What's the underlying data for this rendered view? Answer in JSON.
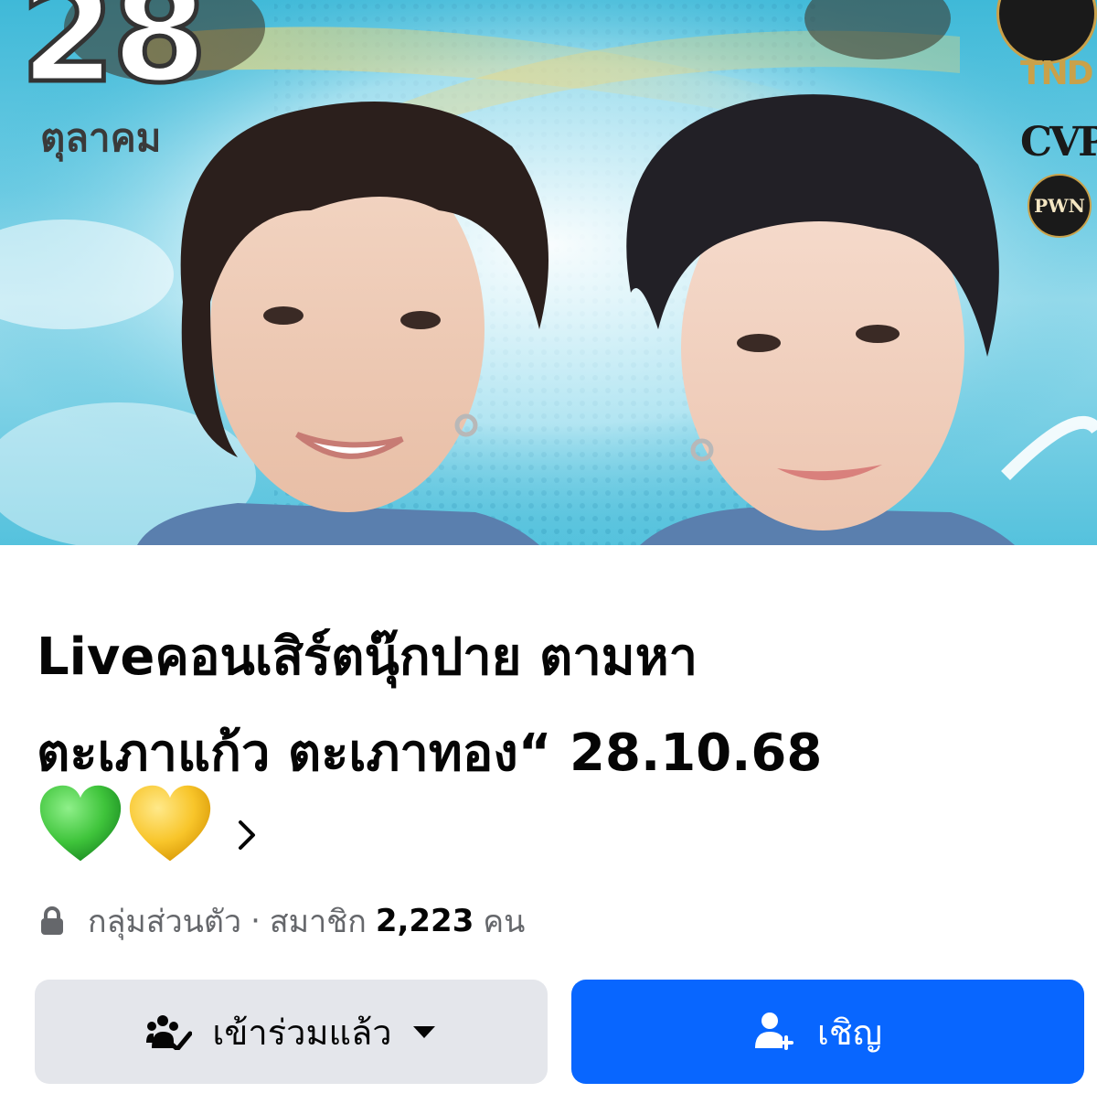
{
  "cover": {
    "date_number": "28",
    "date_month": "ตุลาคม",
    "sponsor_logos": [
      "TND",
      "CVP",
      "PWN"
    ],
    "image_description_icons": [
      "performer-left-photo",
      "performer-right-photo"
    ]
  },
  "group": {
    "title_line1": "Liveคอนเสิร์ตนุ๊กปาย ตามหา",
    "title_line2": "ตะเภาแก้ว ตะเภาทอง“ 28.10.68",
    "title_emoji": [
      "green-heart-icon",
      "yellow-heart-icon"
    ],
    "privacy": "กลุ่มส่วนตัว",
    "separator": "·",
    "members_label": "สมาชิก",
    "members_count": "2,223",
    "members_unit": "คน"
  },
  "actions": {
    "joined_label": "เข้าร่วมแล้ว",
    "invite_label": "เชิญ"
  },
  "colors": {
    "primary_blue": "#0866ff",
    "secondary_gray": "#e4e6eb",
    "text_primary": "#050505",
    "text_secondary": "#65676b"
  }
}
